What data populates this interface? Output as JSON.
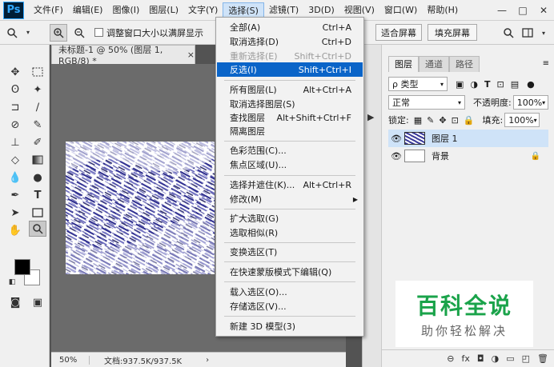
{
  "menubar": {
    "logo": "Ps",
    "items": [
      "文件(F)",
      "编辑(E)",
      "图像(I)",
      "图层(L)",
      "文字(Y)",
      "选择(S)",
      "滤镜(T)",
      "3D(D)",
      "视图(V)",
      "窗口(W)",
      "帮助(H)"
    ],
    "window_controls": [
      "—",
      "□",
      "✕"
    ]
  },
  "options": {
    "checkbox_label": "调整窗口大小以满屏显示",
    "fit_screen": "适合屏幕",
    "fill_screen": "填充屏幕"
  },
  "document": {
    "tab_title": "未标题-1 @ 50% (图层 1, RGB/8) *",
    "tab_close": "×",
    "zoom": "50%",
    "doc_size": "文档:937.5K/937.5K",
    "status_arrow": "›"
  },
  "select_menu": {
    "items": [
      {
        "label": "全部(A)",
        "shortcut": "Ctrl+A"
      },
      {
        "label": "取消选择(D)",
        "shortcut": "Ctrl+D"
      },
      {
        "label": "重新选择(E)",
        "shortcut": "Shift+Ctrl+D"
      },
      {
        "label": "反选(I)",
        "shortcut": "Shift+Ctrl+I"
      },
      {
        "label": "所有图层(L)",
        "shortcut": "Alt+Ctrl+A"
      },
      {
        "label": "取消选择图层(S)",
        "shortcut": ""
      },
      {
        "label": "查找图层",
        "shortcut": "Alt+Shift+Ctrl+F"
      },
      {
        "label": "隔离图层",
        "shortcut": ""
      },
      {
        "label": "色彩范围(C)...",
        "shortcut": ""
      },
      {
        "label": "焦点区域(U)...",
        "shortcut": ""
      },
      {
        "label": "选择并遮住(K)...",
        "shortcut": "Alt+Ctrl+R"
      },
      {
        "label": "修改(M)",
        "shortcut": ""
      },
      {
        "label": "扩大选取(G)",
        "shortcut": ""
      },
      {
        "label": "选取相似(R)",
        "shortcut": ""
      },
      {
        "label": "变换选区(T)",
        "shortcut": ""
      },
      {
        "label": "在快速蒙版模式下编辑(Q)",
        "shortcut": ""
      },
      {
        "label": "载入选区(O)...",
        "shortcut": ""
      },
      {
        "label": "存储选区(V)...",
        "shortcut": ""
      },
      {
        "label": "新建 3D 模型(3)",
        "shortcut": ""
      }
    ],
    "submenu_arrow": "▶"
  },
  "layers_panel": {
    "tabs": [
      "图层",
      "通道",
      "路径"
    ],
    "filter_label": "ρ 类型",
    "blend_mode": "正常",
    "opacity_label": "不透明度:",
    "opacity_value": "100%",
    "lock_label": "锁定:",
    "fill_label": "填充:",
    "fill_value": "100%",
    "layers": [
      {
        "name": "图层 1"
      },
      {
        "name": "背景"
      }
    ],
    "bottom_icons": [
      "⊖",
      "fx",
      "◘",
      "◑",
      "▭",
      "◰",
      "🗑"
    ]
  },
  "watermark": {
    "main": "百科全说",
    "sub": "助你轻松解决"
  },
  "colors": {
    "highlight": "#0a64c8",
    "accent_active": "#cfe3f8",
    "watermark_green": "#1aa34a",
    "canvas_pattern": "#3a3a9a"
  }
}
